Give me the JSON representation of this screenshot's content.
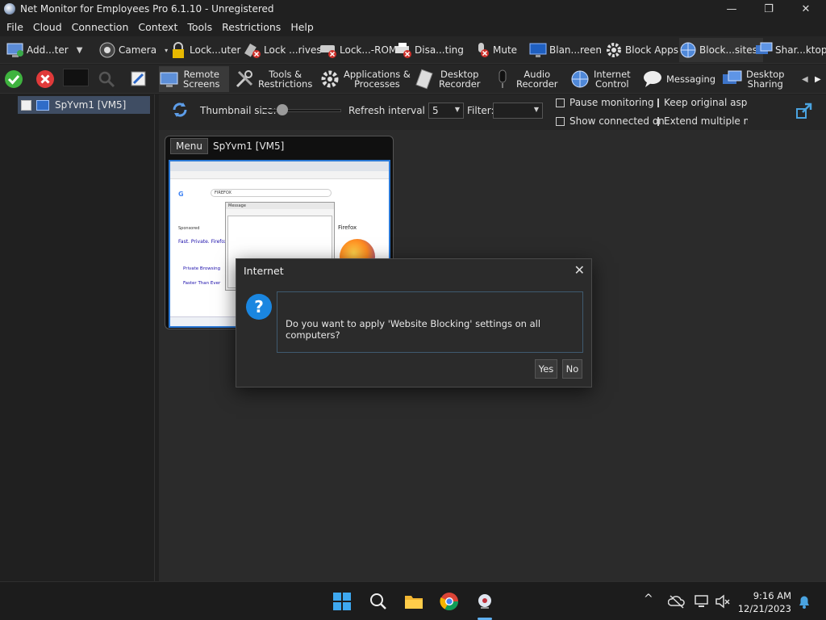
{
  "window": {
    "title": "Net Monitor for Employees Pro 6.1.10 - Unregistered",
    "minimize": "—",
    "maximize": "❐",
    "close": "✕"
  },
  "menu": [
    "File",
    "Cloud",
    "Connection",
    "Context",
    "Tools",
    "Restrictions",
    "Help"
  ],
  "toolbar1": {
    "add_computer": "Add...ter",
    "camera": "Camera",
    "lock_computer": "Lock...uter",
    "lock_drives": "Lock ...rives",
    "lock_cdrom": "Lock...-ROM",
    "disable_something": "Disa...ting",
    "mute": "Mute",
    "blank_screen": "Blan...reen",
    "block_apps": "Block Apps",
    "block_websites": "Block...sites",
    "share_desktop": "Shar...ktop"
  },
  "toolbar2": {
    "remote_screens": "Remote\nScreens",
    "tools_restrictions": "Tools &\nRestrictions",
    "apps_processes": "Applications &\nProcesses",
    "desktop_recorder": "Desktop\nRecorder",
    "audio_recorder": "Audio\nRecorder",
    "internet_control": "Internet\nControl",
    "messaging": "Messaging",
    "desktop_sharing": "Desktop\nSharing"
  },
  "tree": {
    "computer_label": "SpYvm1 [VM5]"
  },
  "filterbar": {
    "thumbnail_label": "Thumbnail size:",
    "thumbnail_level": 0.26,
    "refresh_label": "Refresh interval (s):",
    "refresh_value": "5",
    "filter_label": "Filter:",
    "filter_value": "",
    "pause_monitoring": "Pause monitoring",
    "show_connected": "Show connected on",
    "keep_aspect": "Keep original aspect",
    "extend_monitors": "Extend multiple mon"
  },
  "card": {
    "menu_label": "Menu",
    "title": "SpYvm1 [VM5]"
  },
  "remote_shot": {
    "search_text": "FIREFOX",
    "panel_title": "Firefox",
    "sponsored": "Sponsored",
    "result1": "Fast. Private. Firefox.",
    "result2": "Private Browsing",
    "result3": "Faster Than Ever",
    "dialog_title": "Message"
  },
  "dialog": {
    "title": "Internet",
    "icon": "?",
    "close": "✕",
    "message": "Do you want to apply 'Website Blocking' settings on all computers?",
    "yes": "Yes",
    "no": "No"
  },
  "taskbar": {
    "time": "9:16 AM",
    "date": "12/21/2023",
    "tray_caret": "^"
  },
  "colors": {
    "accent": "#1a86e0",
    "selection": "#3f4d63",
    "background": "#202020"
  }
}
